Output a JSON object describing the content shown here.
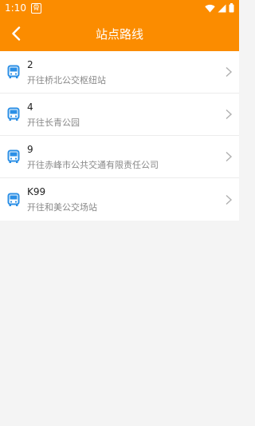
{
  "status_bar": {
    "time": "1:10",
    "notification_glyph": "骨",
    "icons": [
      "wifi-icon",
      "signal-icon",
      "battery-icon"
    ]
  },
  "header": {
    "title": "站点路线",
    "back_icon": "chevron-left-icon"
  },
  "routes": [
    {
      "number": "2",
      "destination": "开往桥北公交枢纽站"
    },
    {
      "number": "4",
      "destination": "开往长青公园"
    },
    {
      "number": "9",
      "destination": "开往赤峰市公共交通有限责任公司"
    },
    {
      "number": "K99",
      "destination": "开往和美公交场站"
    }
  ],
  "colors": {
    "accent": "#fb8c00",
    "bus_icon": "#2b8fe6",
    "background": "#f4f4f4"
  }
}
